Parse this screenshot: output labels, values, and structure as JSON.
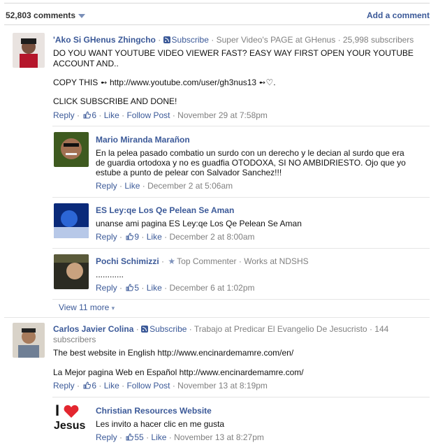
{
  "header": {
    "comment_count": "52,803 comments",
    "add_comment": "Add a comment"
  },
  "comments": [
    {
      "author": "'Ako Si GHenus Zhingcho",
      "subscribe": "Subscribe",
      "meta": "Super Video's PAGE at GHenus",
      "subscribers": "25,998 subscribers",
      "text_lines": [
        "DO YOU WANT YOUTUBE VIDEO VIEWER FAST? EASY WAY FIRST OPEN YOUR YOUTUBE",
        "ACCOUNT AND..",
        "COPY THIS ➻ http://www.youtube.com/user/gh3nus13 ➻♡.",
        "CLICK SUBSCRIBE AND DONE!"
      ],
      "actions": {
        "reply": "Reply",
        "likes": "6",
        "like": "Like",
        "follow": "Follow Post",
        "time": "November 29 at 7:58pm"
      }
    },
    {
      "author": "Carlos Javier Colina",
      "subscribe": "Subscribe",
      "meta": "Trabajo at Predicar El Evangelio De Jesucristo",
      "subscribers_a": "144",
      "subscribers_b": "subscribers",
      "text_lines": [
        "The best website in English http://www.encinardemamre.com/en/",
        "La Mejor pagina Web en Español http://www.encinardemamre.com/"
      ],
      "actions": {
        "reply": "Reply",
        "likes": "6",
        "like": "Like",
        "follow": "Follow Post",
        "time": "November 13 at 8:19pm"
      }
    }
  ],
  "replies": [
    {
      "author": "Mario Miranda Marañon",
      "text_lines": [
        "En la pelea pasado combatio un surdo con un derecho y le decian al surdo que era",
        "de guardia ortodoxa y no es guadfia OTODOXA, SI NO AMBIDRIESTO. Ojo que yo",
        "estube a punto de pelear con Salvador Sanchez!!!"
      ],
      "actions": {
        "reply": "Reply",
        "like": "Like",
        "time": "December 2 at 5:06am"
      }
    },
    {
      "author": "ES Ley:qe Los Qe Pelean Se Aman",
      "text_lines": [
        "unanse ami pagina ES Ley:qe Los Qe Pelean Se Aman"
      ],
      "actions": {
        "reply": "Reply",
        "likes": "9",
        "like": "Like",
        "time": "December 2 at 8:00am"
      }
    },
    {
      "author": "Pochi Schimizzi",
      "badge": "Top Commenter",
      "meta": "Works at NDSHS",
      "text_lines": [
        "............"
      ],
      "actions": {
        "reply": "Reply",
        "likes": "5",
        "like": "Like",
        "time": "December 6 at 1:02pm"
      }
    },
    {
      "author": "Christian Resources Website",
      "logo_text_a": "I",
      "logo_text_b": "Jesus",
      "text_lines": [
        "Les invito a hacer clic en me gusta"
      ],
      "actions": {
        "reply": "Reply",
        "likes": "55",
        "like": "Like",
        "time": "November 13 at 8:27pm"
      }
    }
  ],
  "view_more": "View 11 more",
  "colors": {
    "link": "#3b5998",
    "meta": "#808080",
    "divider": "#e5e5e5"
  }
}
